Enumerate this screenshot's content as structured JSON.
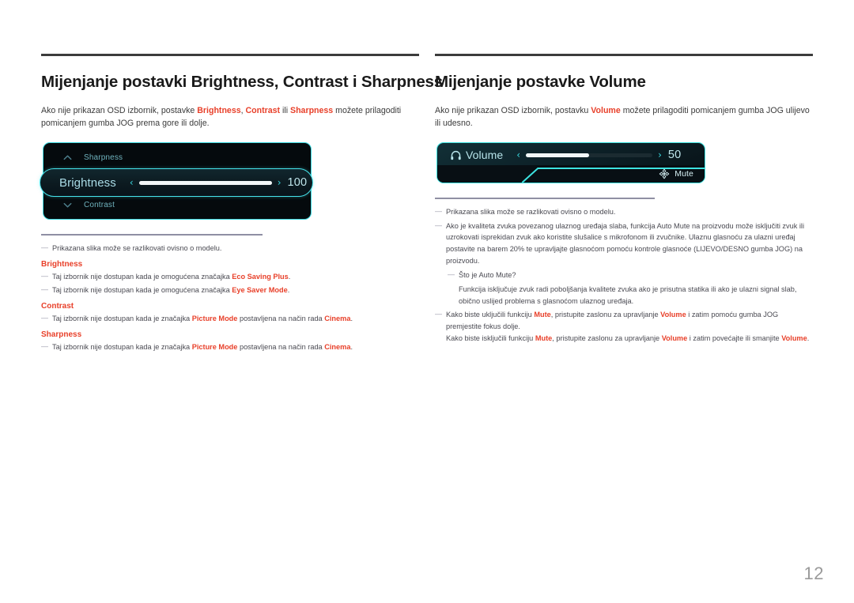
{
  "page": {
    "number": "12",
    "accent_color": "#e8402a",
    "osd_border_color": "#3ad9e0"
  },
  "left_column": {
    "heading": "Mijenjanje postavki Brightness, Contrast i Sharpness",
    "intro": {
      "part1": "Ako nije prikazan OSD izbornik, postavke ",
      "term1": "Brightness",
      "part2": ", ",
      "term2": "Contrast",
      "part3": " ili ",
      "term3": "Sharpness",
      "part4": " možete prilagoditi pomicanjem gumba JOG prema gore ili dolje."
    },
    "osd": {
      "row_top_label": "Sharpness",
      "row_top_icon": "chevron-up-icon",
      "row_bottom_label": "Contrast",
      "row_bottom_icon": "chevron-down-icon",
      "selected_label": "Brightness",
      "selected_value": "100",
      "selected_fill_percent": 100,
      "left_arrow": "‹",
      "right_arrow": "›"
    },
    "notes": {
      "intro_note": "Prikazana slika može se razlikovati ovisno o modelu.",
      "groups": [
        {
          "heading": "Brightness",
          "items": [
            {
              "before": "Taj izbornik nije dostupan kada je omogućena značajka ",
              "term": "Eco Saving Plus",
              "after": "."
            },
            {
              "before": "Taj izbornik nije dostupan kada je omogućena značajka ",
              "term": "Eye Saver Mode",
              "after": "."
            }
          ]
        },
        {
          "heading": "Contrast",
          "items": [
            {
              "before": "Taj izbornik nije dostupan kada je značajka ",
              "term": "Picture Mode",
              "mid": " postavljena na način rada ",
              "term2": "Cinema",
              "after": "."
            }
          ]
        },
        {
          "heading": "Sharpness",
          "items": [
            {
              "before": "Taj izbornik nije dostupan kada je značajka ",
              "term": "Picture Mode",
              "mid": " postavljena na način rada ",
              "term2": "Cinema",
              "after": "."
            }
          ]
        }
      ]
    }
  },
  "right_column": {
    "heading": "Mijenjanje postavke Volume",
    "intro": {
      "part1": "Ako nije prikazan OSD izbornik, postavku ",
      "term1": "Volume",
      "part2": " možete prilagoditi pomicanjem gumba JOG ulijevo ili udesno."
    },
    "osd": {
      "icon": "headphone-icon",
      "label": "Volume",
      "value": "50",
      "fill_percent": 50,
      "left_arrow": "‹",
      "right_arrow": "›",
      "mute_icon": "jog-directional-icon",
      "mute_label": "Mute"
    },
    "notes": {
      "note1": "Prikazana slika može se razlikovati ovisno o modelu.",
      "note2": "Ako je kvaliteta zvuka povezanog ulaznog uređaja slaba, funkcija Auto Mute na proizvodu može isključiti zvuk ili uzrokovati isprekidan zvuk ako koristite slušalice s mikrofonom ili zvučnike. Ulaznu glasnoću za ulazni uređaj postavite na barem 20% te upravljajte glasnoćom pomoću kontrole glasnoće (LIJEVO/DESNO gumba JOG) na proizvodu.",
      "note2_sub_question": "Što je Auto Mute?",
      "note2_sub_answer": "Funkcija isključuje zvuk radi poboljšanja kvalitete zvuka ako je prisutna statika ili ako je ulazni signal slab, obično uslijed problema s glasnoćom ulaznog uređaja.",
      "note3": {
        "line1_before": "Kako biste uključili funkciju ",
        "line1_term1": "Mute",
        "line1_mid": ", pristupite zaslonu za upravljanje ",
        "line1_term2": "Volume",
        "line1_after": " i zatim pomoću gumba JOG premjestite fokus dolje.",
        "line2_before": "Kako biste isključili funkciju ",
        "line2_term1": "Mute",
        "line2_mid": ", pristupite zaslonu za upravljanje ",
        "line2_term2": "Volume",
        "line2_after": " i zatim povećajte ili smanjite ",
        "line2_term3": "Volume",
        "line2_end": "."
      }
    }
  }
}
